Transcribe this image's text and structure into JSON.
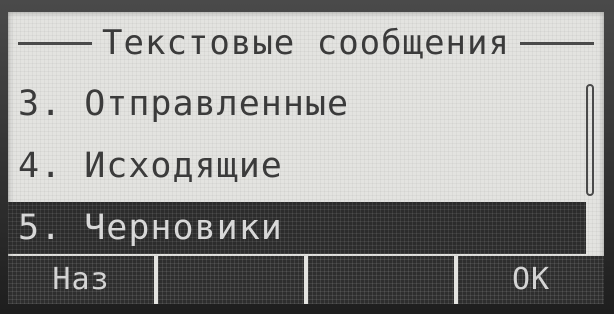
{
  "screen": {
    "title": "Текстовые сообщения"
  },
  "menu": {
    "items": [
      {
        "label": "3. Отправленные",
        "selected": false
      },
      {
        "label": "4. Исходящие",
        "selected": false
      },
      {
        "label": "5. Черновики",
        "selected": true
      }
    ]
  },
  "softkeys": [
    {
      "label": "Наз"
    },
    {
      "label": ""
    },
    {
      "label": ""
    },
    {
      "label": "OK"
    }
  ],
  "colors": {
    "lcd_background": "#e3e3e0",
    "text": "#3b3b3b",
    "highlight": "#2c2c2c",
    "highlight_text": "#d8d8d8"
  }
}
